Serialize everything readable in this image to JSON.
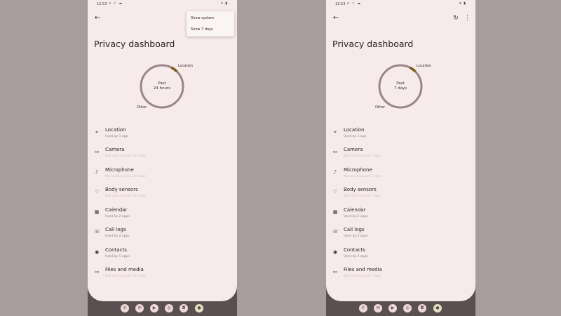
{
  "status": {
    "time": "12:53"
  },
  "menu": {
    "items": [
      "Show system",
      "Show 7 days"
    ]
  },
  "left": {
    "title": "Privacy dashboard",
    "ring": {
      "line1": "Past",
      "line2": "24 hours",
      "label_top": "Location",
      "label_bottom": "Other"
    },
    "items": [
      {
        "name": "Location",
        "sub": "Used by 1 app",
        "faint": false,
        "icon": "location-pin-icon"
      },
      {
        "name": "Camera",
        "sub": "Not used in past 24 hours",
        "faint": true,
        "icon": "camera-icon"
      },
      {
        "name": "Microphone",
        "sub": "Not used in past 24 hours",
        "faint": true,
        "icon": "microphone-icon"
      },
      {
        "name": "Body sensors",
        "sub": "Not used in past 24 hours",
        "faint": true,
        "icon": "heart-icon"
      },
      {
        "name": "Calendar",
        "sub": "Used by 2 apps",
        "faint": false,
        "icon": "calendar-icon"
      },
      {
        "name": "Call logs",
        "sub": "Used by 2 apps",
        "faint": false,
        "icon": "call-log-icon"
      },
      {
        "name": "Contacts",
        "sub": "Used by 5 apps",
        "faint": false,
        "icon": "contacts-icon"
      },
      {
        "name": "Files and media",
        "sub": "Not used in past 24 hours",
        "faint": true,
        "icon": "folder-icon"
      }
    ]
  },
  "right": {
    "title": "Privacy dashboard",
    "ring": {
      "line1": "Past",
      "line2": "7 days",
      "label_top": "Location",
      "label_bottom": "Other"
    },
    "items": [
      {
        "name": "Location",
        "sub": "Used by 1 app",
        "faint": false,
        "icon": "location-pin-icon"
      },
      {
        "name": "Camera",
        "sub": "Not used in past 7 days",
        "faint": true,
        "icon": "camera-icon"
      },
      {
        "name": "Microphone",
        "sub": "Not used in past 7 days",
        "faint": true,
        "icon": "microphone-icon"
      },
      {
        "name": "Body sensors",
        "sub": "Not used in past 7 days",
        "faint": true,
        "icon": "heart-icon"
      },
      {
        "name": "Calendar",
        "sub": "Used by 2 apps",
        "faint": false,
        "icon": "calendar-icon"
      },
      {
        "name": "Call logs",
        "sub": "Used by 2 apps",
        "faint": false,
        "icon": "call-log-icon"
      },
      {
        "name": "Contacts",
        "sub": "Used by 5 apps",
        "faint": false,
        "icon": "contacts-icon"
      },
      {
        "name": "Files and media",
        "sub": "Not used in past 7 days",
        "faint": true,
        "icon": "folder-icon"
      }
    ]
  },
  "colors": {
    "ring": "#9a8589",
    "ring_accent": "#7a5a1e"
  }
}
